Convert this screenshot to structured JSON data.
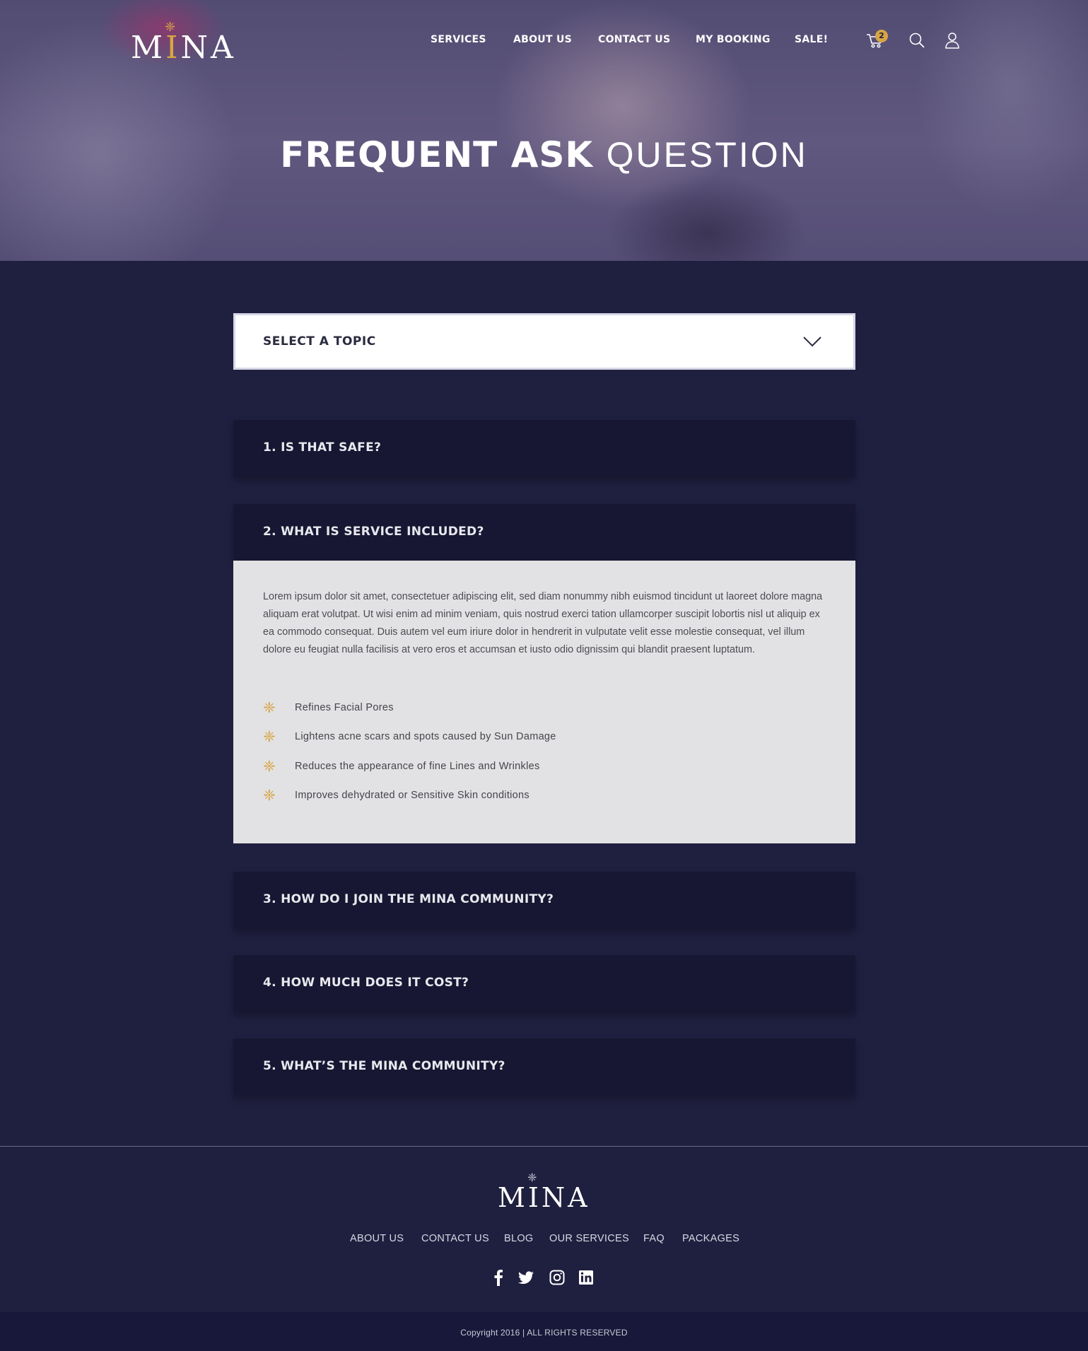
{
  "brand": {
    "name_pre": "M",
    "name_accent": "I",
    "name_post": "NA",
    "accent_color": "#d8a545"
  },
  "nav": {
    "items": [
      "SERVICES",
      "ABOUT US",
      "CONTACT US",
      "MY BOOKING",
      "SALE!"
    ],
    "cart_count": "2"
  },
  "hero": {
    "title_bold": "FREQUENT ASK",
    "title_light": "QUESTION"
  },
  "topic_select": {
    "label": "SELECT A TOPIC"
  },
  "faq": {
    "items": [
      {
        "question": "1. IS THAT SAFE?",
        "expanded": false
      },
      {
        "question": "2. WHAT IS SERVICE INCLUDED?",
        "expanded": true
      },
      {
        "question": "3. HOW DO I JOIN THE MINA COMMUNITY?",
        "expanded": false
      },
      {
        "question": "4. HOW MUCH DOES IT COST?",
        "expanded": false
      },
      {
        "question": "5. WHAT’S THE MINA COMMUNITY?",
        "expanded": false
      }
    ],
    "answer": {
      "text": "Lorem ipsum dolor sit amet, consectetuer adipiscing elit, sed diam nonummy nibh euismod tincidunt ut laoreet dolore magna aliquam erat volutpat. Ut wisi enim ad minim veniam, quis nostrud exerci tation ullamcorper suscipit lobortis nisl ut aliquip ex ea commodo consequat. Duis autem vel eum iriure dolor in hendrerit in vulputate velit esse molestie consequat, vel illum dolore eu feugiat nulla facilisis at vero eros et accumsan et iusto odio dignissim qui blandit praesent luptatum.",
      "bullets": [
        "Refines Facial Pores",
        "Lightens acne scars and spots caused by Sun Damage",
        "Reduces the appearance of fine Lines and Wrinkles",
        "Improves dehydrated or Sensitive Skin conditions"
      ]
    }
  },
  "footer": {
    "logo": "MINA",
    "links": [
      "ABOUT US",
      "CONTACT US",
      "BLOG",
      "OUR SERVICES",
      "FAQ",
      "PACKAGES"
    ],
    "social": [
      "facebook-icon",
      "twitter-icon",
      "instagram-icon",
      "linkedin-icon"
    ],
    "copyright": "Copyright 2016 | ALL RIGHTS RESERVED"
  },
  "colors": {
    "background": "#1f1f3f",
    "faq_bar": "#171733",
    "answer_bg": "#e2e2e4",
    "gold": "#d8a545"
  }
}
